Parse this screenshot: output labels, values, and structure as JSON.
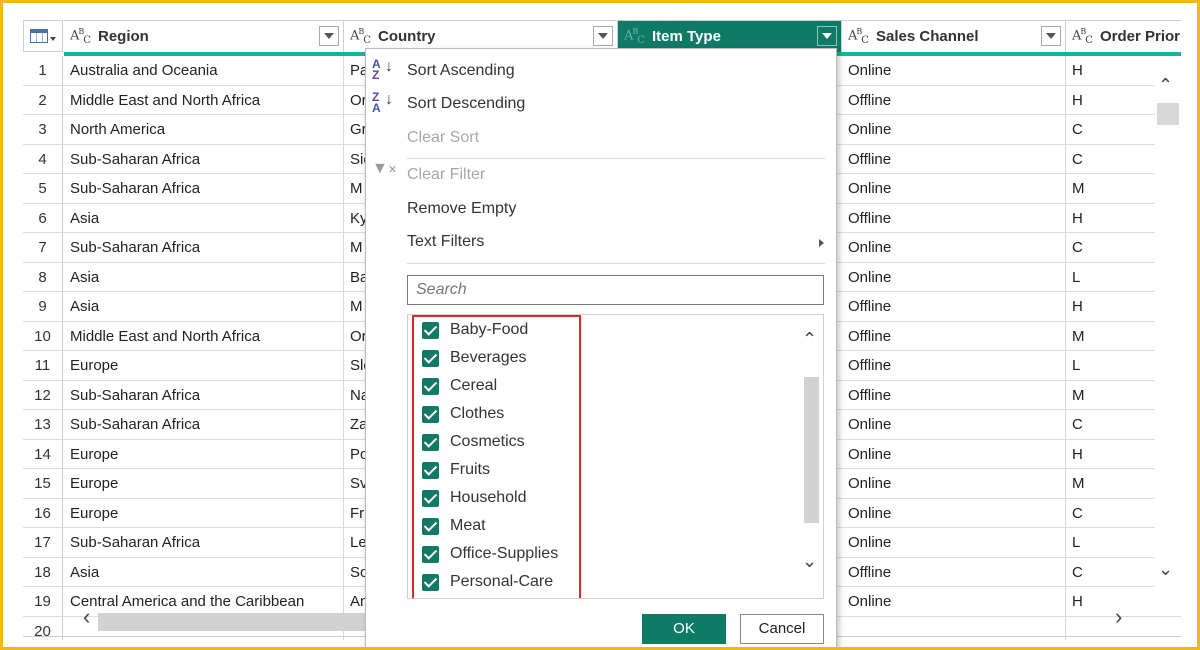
{
  "columns": [
    {
      "type": "ABC",
      "label": "Region"
    },
    {
      "type": "ABC",
      "label": "Country"
    },
    {
      "type": "ABC",
      "label": "Item Type"
    },
    {
      "type": "ABC",
      "label": "Sales Channel"
    },
    {
      "type": "ABC",
      "label": "Order Prior"
    }
  ],
  "rows": [
    {
      "n": "1",
      "region": "Australia and Oceania",
      "country": "Pa",
      "channel": "Online",
      "priority": "H"
    },
    {
      "n": "2",
      "region": "Middle East and North Africa",
      "country": "Or",
      "channel": "Offline",
      "priority": "H"
    },
    {
      "n": "3",
      "region": "North America",
      "country": "Gr",
      "channel": "Online",
      "priority": "C"
    },
    {
      "n": "4",
      "region": "Sub-Saharan Africa",
      "country": "Sie",
      "channel": "Offline",
      "priority": "C"
    },
    {
      "n": "5",
      "region": "Sub-Saharan Africa",
      "country": "M",
      "channel": "Online",
      "priority": "M"
    },
    {
      "n": "6",
      "region": "Asia",
      "country": "Ky",
      "channel": "Offline",
      "priority": "H"
    },
    {
      "n": "7",
      "region": "Sub-Saharan Africa",
      "country": "M",
      "channel": "Online",
      "priority": "C"
    },
    {
      "n": "8",
      "region": "Asia",
      "country": "Ba",
      "channel": "Online",
      "priority": "L"
    },
    {
      "n": "9",
      "region": "Asia",
      "country": "M",
      "channel": "Offline",
      "priority": "H"
    },
    {
      "n": "10",
      "region": "Middle East and North Africa",
      "country": "Or",
      "channel": "Offline",
      "priority": "M"
    },
    {
      "n": "11",
      "region": "Europe",
      "country": "Slo",
      "channel": "Offline",
      "priority": "L"
    },
    {
      "n": "12",
      "region": "Sub-Saharan Africa",
      "country": "Na",
      "channel": "Offline",
      "priority": "M"
    },
    {
      "n": "13",
      "region": "Sub-Saharan Africa",
      "country": "Za",
      "channel": "Online",
      "priority": "C"
    },
    {
      "n": "14",
      "region": "Europe",
      "country": "Po",
      "channel": "Online",
      "priority": "H"
    },
    {
      "n": "15",
      "region": "Europe",
      "country": "Sv",
      "channel": "Online",
      "priority": "M"
    },
    {
      "n": "16",
      "region": "Europe",
      "country": "Fr",
      "channel": "Online",
      "priority": "C"
    },
    {
      "n": "17",
      "region": "Sub-Saharan Africa",
      "country": "Le",
      "channel": "Online",
      "priority": "L"
    },
    {
      "n": "18",
      "region": "Asia",
      "country": "So",
      "channel": "Offline",
      "priority": "C"
    },
    {
      "n": "19",
      "region": "Central America and the Caribbean",
      "country": "An",
      "channel": "Online",
      "priority": "H"
    },
    {
      "n": "20",
      "region": "",
      "country": "",
      "channel": "",
      "priority": ""
    }
  ],
  "menu": {
    "sort_asc": "Sort Ascending",
    "sort_desc": "Sort Descending",
    "clear_sort": "Clear Sort",
    "clear_filter": "Clear Filter",
    "remove_empty": "Remove Empty",
    "text_filters": "Text Filters",
    "search_placeholder": "Search",
    "items": [
      "Baby-Food",
      "Beverages",
      "Cereal",
      "Clothes",
      "Cosmetics",
      "Fruits",
      "Household",
      "Meat",
      "Office-Supplies",
      "Personal-Care"
    ],
    "ok": "OK",
    "cancel": "Cancel"
  },
  "colors": {
    "accent": "#0f7a66",
    "teal_bar": "#13b39c",
    "frame": "#f2b81a",
    "highlight": "#e0262b"
  }
}
